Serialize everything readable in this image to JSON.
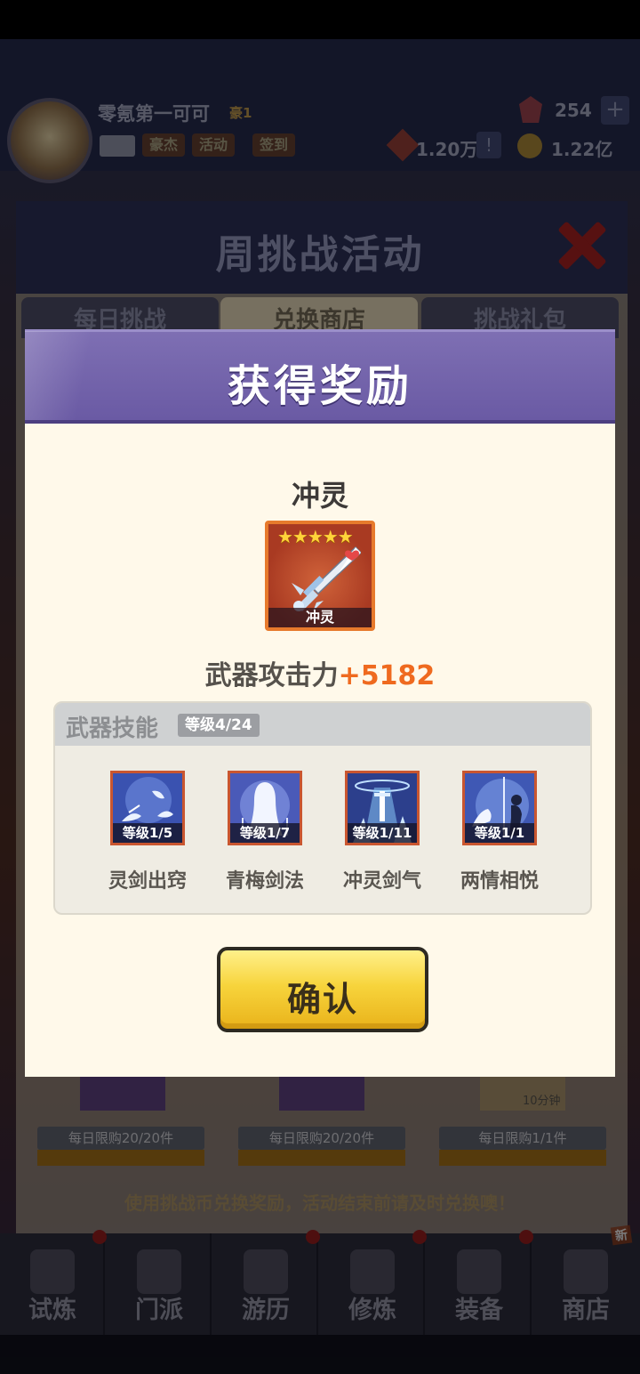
{
  "player": {
    "name": "零氪第一可可",
    "rank": "豪1",
    "tags": [
      "豪杰",
      "活动",
      "签到"
    ]
  },
  "resources": {
    "gems": "254",
    "power": "1.20万",
    "gold": "1.22亿"
  },
  "background_panel": {
    "title": "周挑战活动",
    "tabs": [
      "每日挑战",
      "兑换商店",
      "挑战礼包"
    ],
    "active_tab": "兑换商店",
    "card_limits": [
      "每日限购20/20件",
      "每日限购20/20件",
      "每日限购1/1件"
    ],
    "card_badge": "10分钟",
    "note": "使用挑战币兑换奖励，活动结束前请及时兑换噢！"
  },
  "bottom_nav": {
    "items": [
      "试炼",
      "门派",
      "游历",
      "修炼",
      "装备",
      "商店"
    ],
    "new_badge": "新"
  },
  "reward_dialog": {
    "title": "获得奖励",
    "item_name": "冲灵",
    "item_caption": "冲灵",
    "stars": "★★★★★",
    "attack_label": "武器攻击力",
    "attack_value": "+5182",
    "skills_header": "武器技能",
    "skills_level": "等级4/24",
    "skills": [
      {
        "name": "灵剑出窍",
        "level": "等级1/5"
      },
      {
        "name": "青梅剑法",
        "level": "等级1/7"
      },
      {
        "name": "冲灵剑气",
        "level": "等级1/11"
      },
      {
        "name": "两情相悦",
        "level": "等级1/1"
      }
    ],
    "confirm_label": "确认"
  },
  "colors": {
    "dialog_header": "#6a5aa4",
    "attack_value": "#ef6a1f",
    "confirm_button": "#f7d43c",
    "item_frame": "#e77a2c"
  }
}
